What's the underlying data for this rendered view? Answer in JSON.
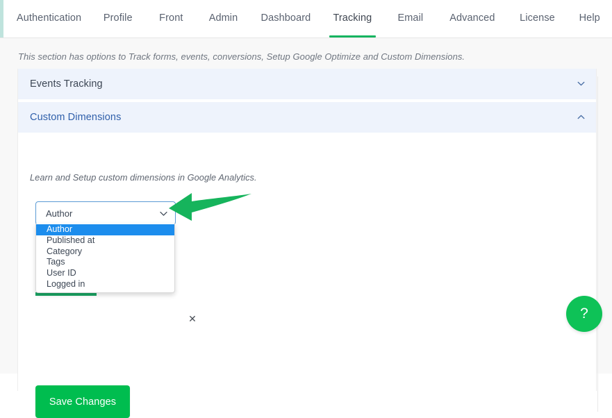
{
  "tabs": [
    {
      "label": "Authentication",
      "active": false
    },
    {
      "label": "Profile",
      "active": false
    },
    {
      "label": "Front",
      "active": false
    },
    {
      "label": "Admin",
      "active": false
    },
    {
      "label": "Dashboard",
      "active": false
    },
    {
      "label": "Tracking",
      "active": true
    },
    {
      "label": "Email",
      "active": false
    },
    {
      "label": "Advanced",
      "active": false
    },
    {
      "label": "License",
      "active": false
    },
    {
      "label": "Help",
      "active": false
    }
  ],
  "page": {
    "section_description": "This section has options to Track forms, events, conversions, Setup Google Optimize and Custom Dimensions."
  },
  "accordions": [
    {
      "title": "Events Tracking",
      "expanded": false,
      "chevron": "chevron-down-icon"
    },
    {
      "title": "Custom Dimensions",
      "expanded": true,
      "chevron": "chevron-up-icon"
    }
  ],
  "custom_dimensions": {
    "learn_text": "Learn and Setup custom dimensions in Google Analytics.",
    "select": {
      "value": "Author",
      "chevron": "chevron-down-icon",
      "options": [
        {
          "label": "Author",
          "selected": true
        },
        {
          "label": "Published at",
          "selected": false
        },
        {
          "label": "Category",
          "selected": false
        },
        {
          "label": "Tags",
          "selected": false
        },
        {
          "label": "User ID",
          "selected": false
        },
        {
          "label": "Logged in",
          "selected": false
        }
      ]
    },
    "remove_label": "✕"
  },
  "save_button": {
    "label": "Save Changes"
  },
  "help_bubble": {
    "label": "?"
  },
  "annotation": {
    "icon": "green-arrow-left-icon"
  },
  "colors": {
    "accent_green": "#00bd4f",
    "tab_underline_green": "#16b460",
    "accordion_bg": "#eef3fc",
    "accordion_active_text": "#2f5faa",
    "option_selected_bg": "#1c8ded",
    "select_border_focus": "#5a9ad4",
    "annotation_green": "#16b45c",
    "help_bubble_green": "#0ec257",
    "page_bg": "#f8f8f8"
  }
}
